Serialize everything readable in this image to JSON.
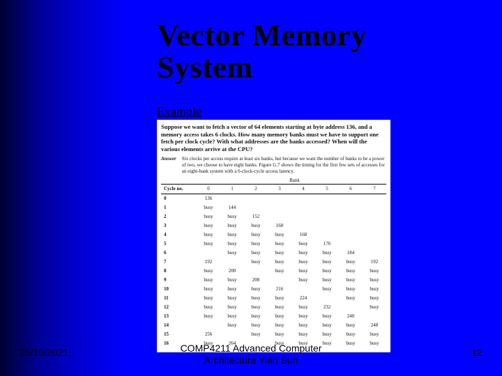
{
  "title_line1": "Vector Memory",
  "title_line2": "System",
  "example_label": "Example",
  "question": "Suppose we want to fetch a vector of 64 elements starting at byte address 136, and a memory access takes 6 clocks. How many memory banks must we have to support one fetch per clock cycle? With what addresses are the banks accessed? When will the various elements arrive at the CPU?",
  "answer_label": "Answer",
  "answer_text": "Six clocks per access require at least six banks, but because we want the number of banks to be a power of two, we choose to have eight banks. Figure G.7 shows the timing for the first few sets of accesses for an eight-bank system with a 6-clock-cycle access latency.",
  "bank_header": "Bank",
  "columns": [
    "Cycle no.",
    "0",
    "1",
    "2",
    "3",
    "4",
    "5",
    "6",
    "7"
  ],
  "rows": [
    {
      "cycle": "0",
      "cells": [
        "136",
        "",
        "",
        "",
        "",
        "",
        "",
        ""
      ]
    },
    {
      "cycle": "1",
      "cells": [
        "busy",
        "144",
        "",
        "",
        "",
        "",
        "",
        ""
      ]
    },
    {
      "cycle": "2",
      "cells": [
        "busy",
        "busy",
        "152",
        "",
        "",
        "",
        "",
        ""
      ]
    },
    {
      "cycle": "3",
      "cells": [
        "busy",
        "busy",
        "busy",
        "160",
        "",
        "",
        "",
        ""
      ]
    },
    {
      "cycle": "4",
      "cells": [
        "busy",
        "busy",
        "busy",
        "busy",
        "168",
        "",
        "",
        ""
      ]
    },
    {
      "cycle": "5",
      "cells": [
        "busy",
        "busy",
        "busy",
        "busy",
        "busy",
        "176",
        "",
        ""
      ]
    },
    {
      "cycle": "6",
      "cells": [
        "",
        "busy",
        "busy",
        "busy",
        "busy",
        "busy",
        "184",
        ""
      ]
    },
    {
      "cycle": "7",
      "cells": [
        "192",
        "",
        "busy",
        "busy",
        "busy",
        "busy",
        "busy",
        "192"
      ]
    },
    {
      "cycle": "8",
      "cells": [
        "busy",
        "200",
        "",
        "busy",
        "busy",
        "busy",
        "busy",
        "busy"
      ]
    },
    {
      "cycle": "9",
      "cells": [
        "busy",
        "busy",
        "208",
        "",
        "busy",
        "busy",
        "busy",
        "busy"
      ]
    },
    {
      "cycle": "10",
      "cells": [
        "busy",
        "busy",
        "busy",
        "216",
        "",
        "busy",
        "busy",
        "busy"
      ]
    },
    {
      "cycle": "11",
      "cells": [
        "busy",
        "busy",
        "busy",
        "busy",
        "224",
        "",
        "busy",
        "busy"
      ]
    },
    {
      "cycle": "12",
      "cells": [
        "busy",
        "busy",
        "busy",
        "busy",
        "busy",
        "232",
        "",
        "busy"
      ]
    },
    {
      "cycle": "13",
      "cells": [
        "busy",
        "busy",
        "busy",
        "busy",
        "busy",
        "busy",
        "240",
        ""
      ]
    },
    {
      "cycle": "14",
      "cells": [
        "",
        "busy",
        "busy",
        "busy",
        "busy",
        "busy",
        "busy",
        "248"
      ]
    },
    {
      "cycle": "15",
      "cells": [
        "256",
        "",
        "busy",
        "busy",
        "busy",
        "busy",
        "busy",
        "busy"
      ]
    },
    {
      "cycle": "16",
      "cells": [
        "busy",
        "264",
        "",
        "busy",
        "busy",
        "busy",
        "busy",
        "busy"
      ]
    }
  ],
  "footer": {
    "date": "25/10/2021",
    "center": "COMP4211 Advanced Computer\nArchitecture  Yian Sun",
    "page": "12"
  }
}
